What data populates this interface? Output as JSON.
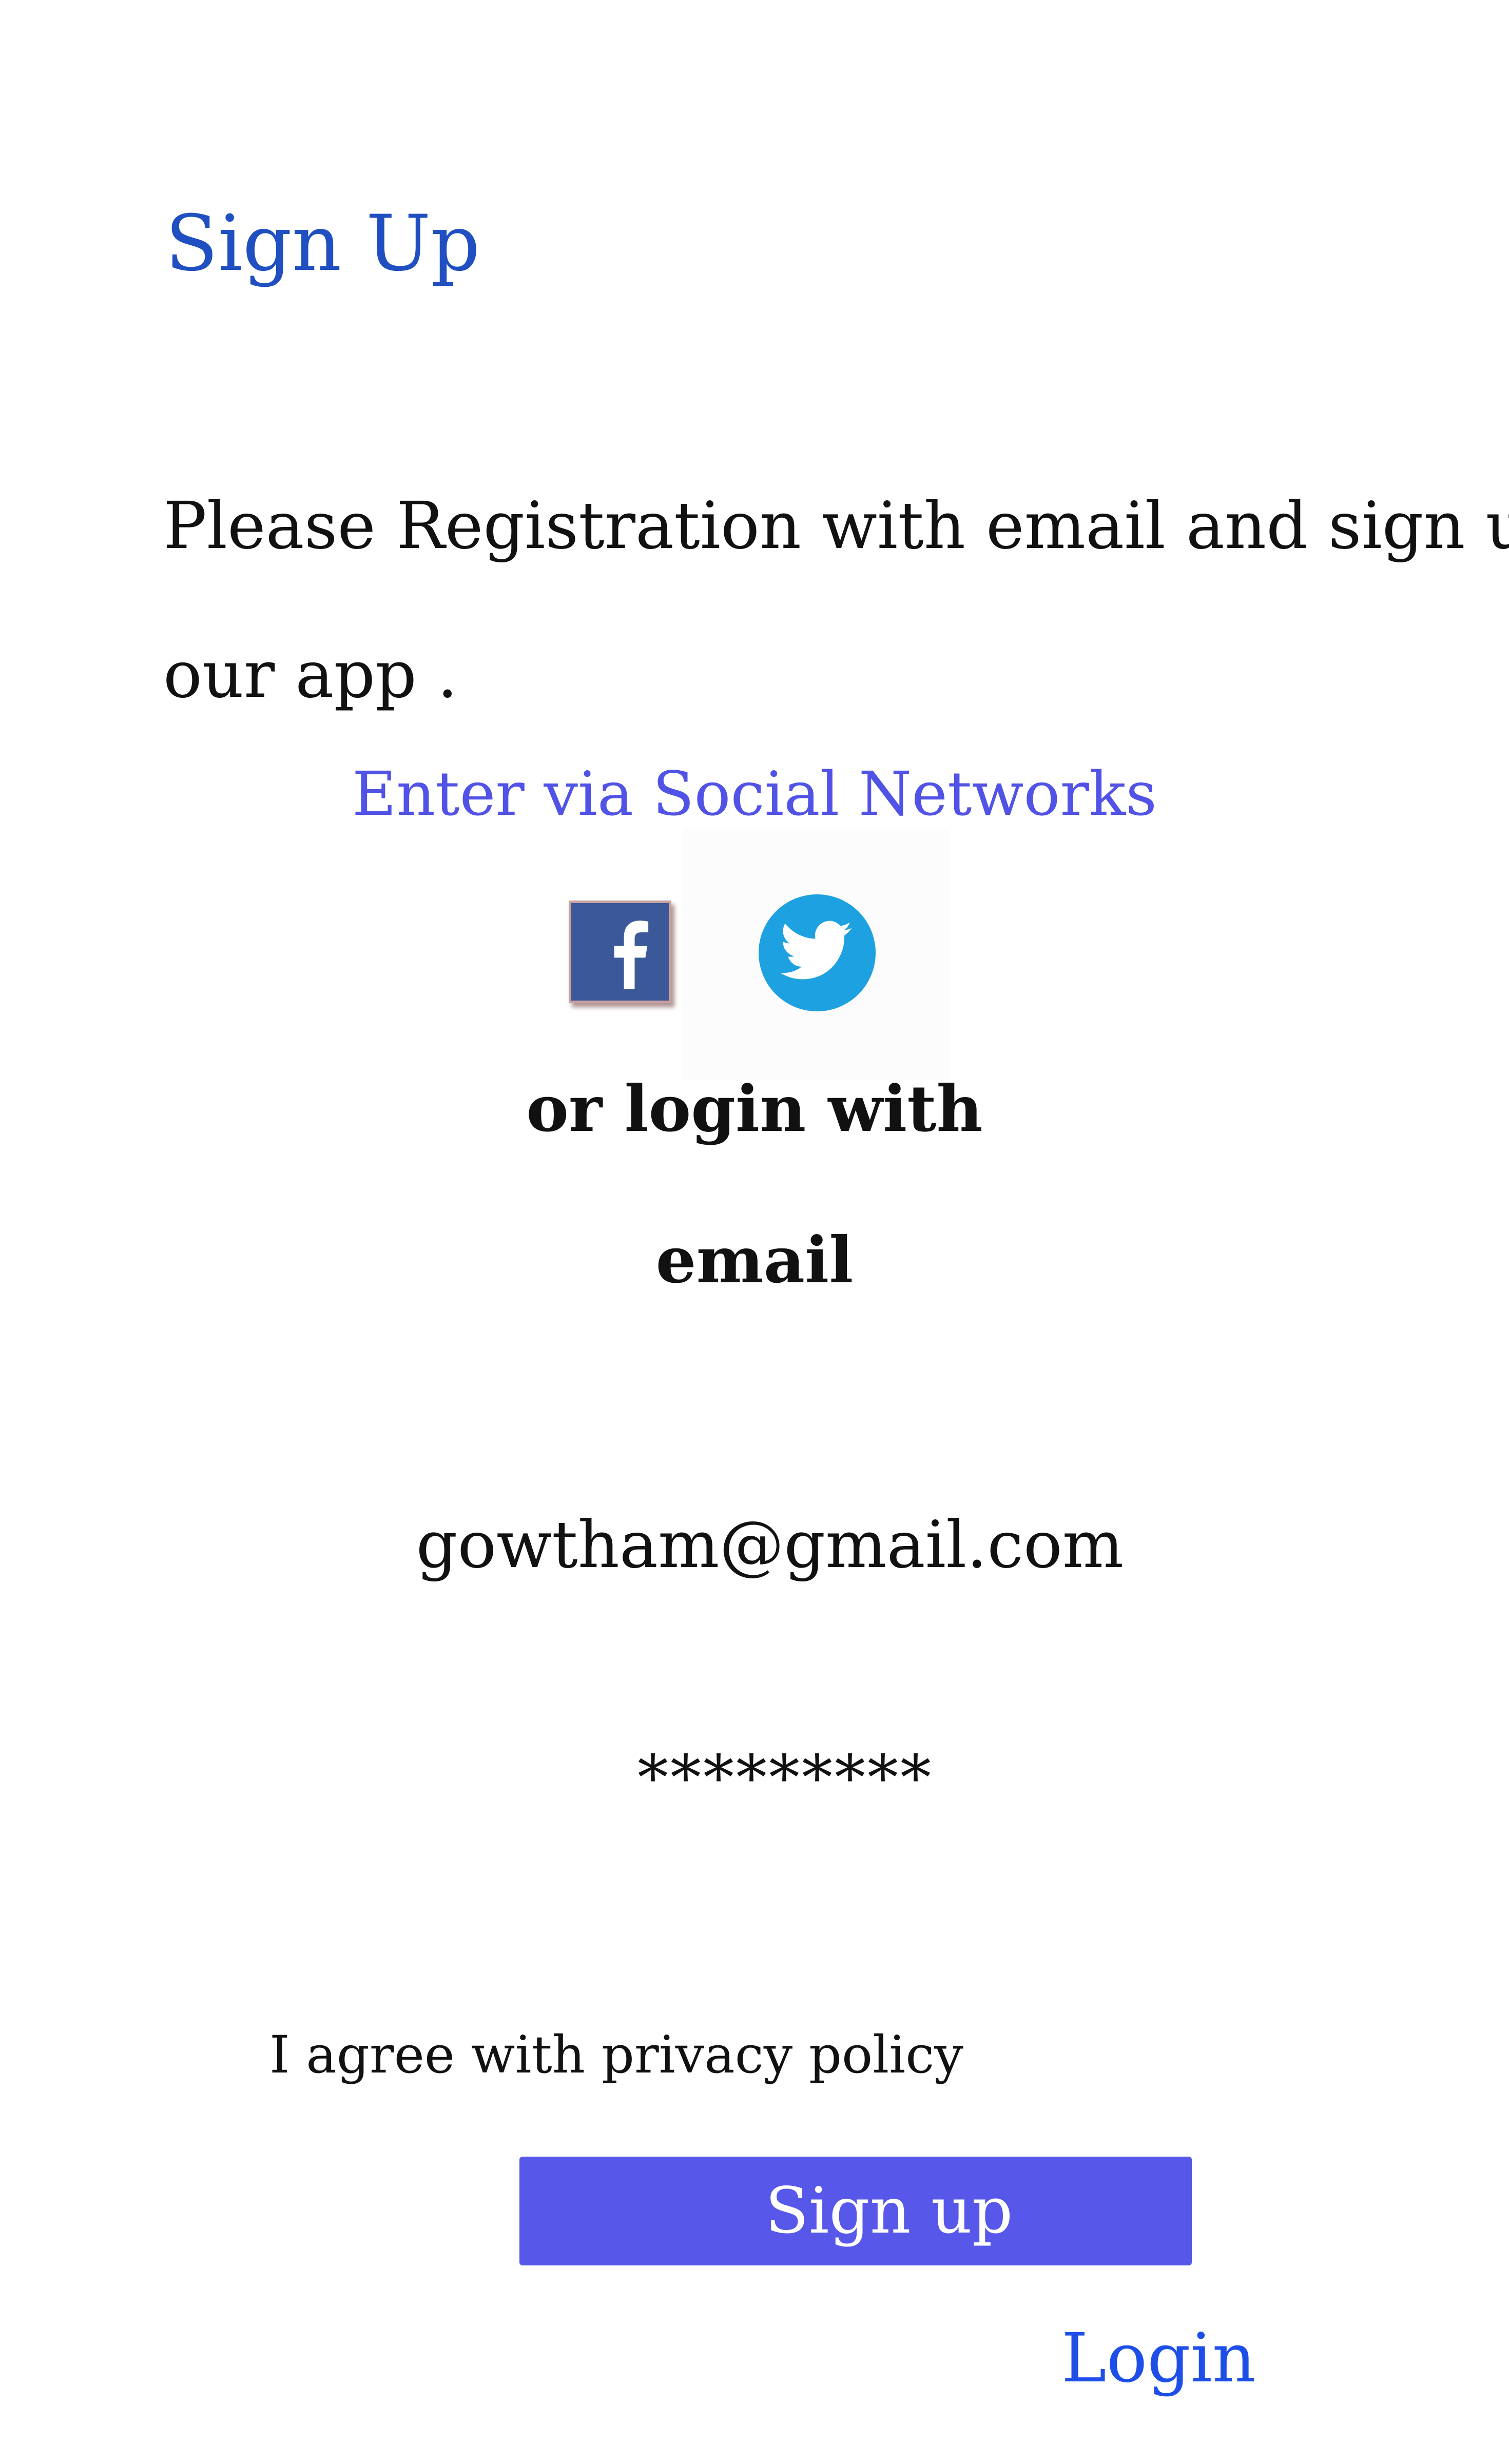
{
  "header": {
    "title": "Sign Up"
  },
  "intro": {
    "line1": "Please Registration with email and sign up",
    "line2": "our app ."
  },
  "social": {
    "heading": "Enter via Social Networks",
    "buttons": [
      {
        "icon": "facebook-icon",
        "color": "#3b5998"
      },
      {
        "icon": "twitter-icon",
        "color": "#1da1e0"
      }
    ]
  },
  "form": {
    "or_login_label": "or login with",
    "email_label": "email",
    "email_value": "gowtham@gmail.com",
    "password_value": "*********",
    "agree_label": "I agree with privacy policy",
    "signup_label": "Sign up",
    "login_label": "Login"
  },
  "colors": {
    "title": "#1f4fc0",
    "social_heading": "#5152e6",
    "button_bg": "#5757ea",
    "link": "#1d4fe8"
  }
}
